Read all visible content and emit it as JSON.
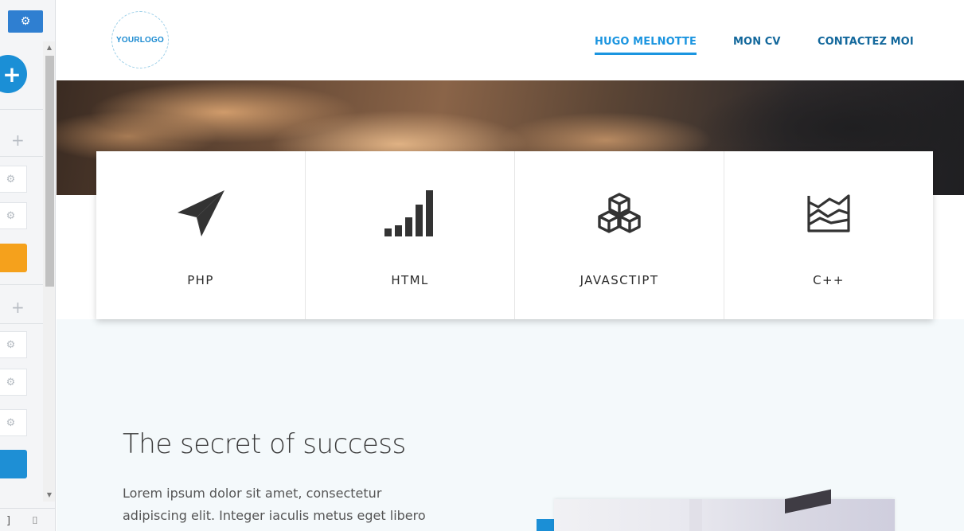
{
  "logo": {
    "text": "YOURLOGO"
  },
  "nav": {
    "items": [
      {
        "label": "HUGO MELNOTTE",
        "active": true
      },
      {
        "label": "MON CV",
        "active": false
      },
      {
        "label": "CONTACTEZ MOI",
        "active": false
      }
    ]
  },
  "features": [
    {
      "label": "PHP",
      "icon": "paper-plane-icon"
    },
    {
      "label": "HTML",
      "icon": "signal-bars-icon"
    },
    {
      "label": "JAVASCTIPT",
      "icon": "cubes-icon"
    },
    {
      "label": "C++",
      "icon": "area-chart-icon"
    }
  ],
  "section": {
    "title": "The secret of success",
    "body_line1": "Lorem ipsum dolor sit amet, consectetur",
    "body_line2": "adipiscing elit. Integer iaculis metus eget libero"
  },
  "editor": {
    "add_symbol": "+",
    "plus_symbol": "+",
    "gear_symbol": "⚙"
  },
  "colors": {
    "accent": "#1b95e0",
    "nav": "#13689c",
    "editor_blue": "#2f7fd1",
    "editor_orange": "#f5a11c"
  }
}
